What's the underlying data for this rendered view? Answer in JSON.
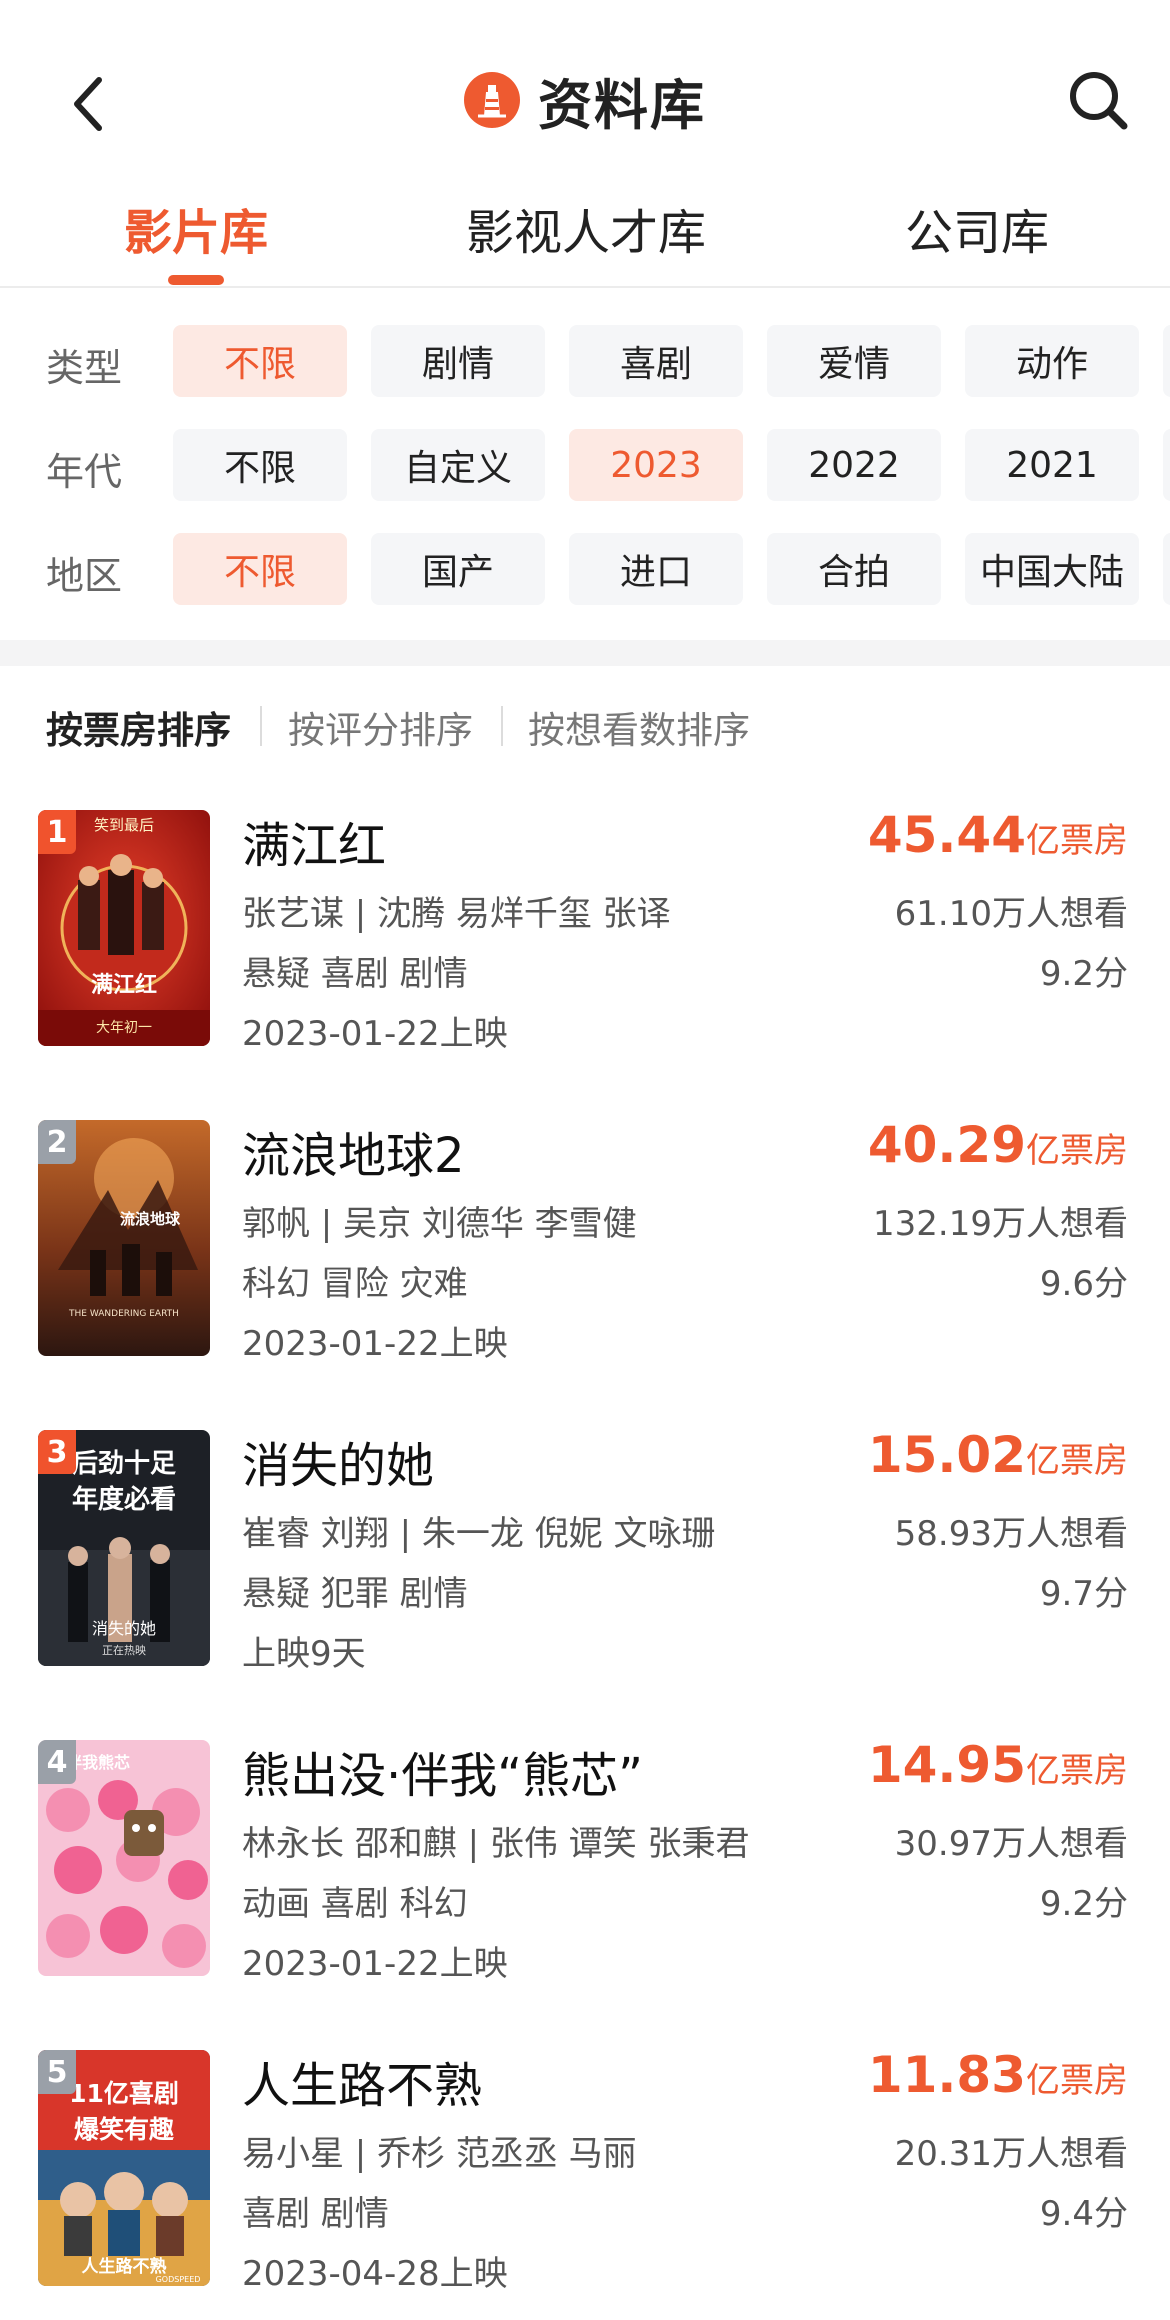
{
  "header": {
    "title": "资料库",
    "back_icon": "chevron-left-icon",
    "logo_icon": "lighthouse-logo-icon",
    "search_icon": "search-icon"
  },
  "tabs": [
    {
      "label": "影片库",
      "active": true
    },
    {
      "label": "影视人才库",
      "active": false
    },
    {
      "label": "公司库",
      "active": false
    }
  ],
  "filters": [
    {
      "label": "类型",
      "options": [
        "不限",
        "剧情",
        "喜剧",
        "爱情",
        "动作"
      ],
      "selected": "不限"
    },
    {
      "label": "年代",
      "options": [
        "不限",
        "自定义",
        "2023",
        "2022",
        "2021"
      ],
      "selected": "2023"
    },
    {
      "label": "地区",
      "options": [
        "不限",
        "国产",
        "进口",
        "合拍",
        "中国大陆"
      ],
      "selected": "不限"
    }
  ],
  "sort": {
    "options": [
      "按票房排序",
      "按评分排序",
      "按想看数排序"
    ],
    "selected": "按票房排序"
  },
  "box_unit": "亿票房",
  "movies": [
    {
      "rank": "1",
      "title": "满江红",
      "cast": "张艺谋 | 沈腾 易烊千玺 张译",
      "genres": "悬疑 喜剧 剧情",
      "release": "2023-01-22上映",
      "box_office": "45.44",
      "want": "61.10万人想看",
      "score": "9.2分"
    },
    {
      "rank": "2",
      "title": "流浪地球2",
      "cast": "郭帆 | 吴京 刘德华 李雪健",
      "genres": "科幻 冒险 灾难",
      "release": "2023-01-22上映",
      "box_office": "40.29",
      "want": "132.19万人想看",
      "score": "9.6分"
    },
    {
      "rank": "3",
      "title": "消失的她",
      "cast": "崔睿 刘翔 | 朱一龙 倪妮 文咏珊",
      "genres": "悬疑 犯罪 剧情",
      "release": "上映9天",
      "box_office": "15.02",
      "want": "58.93万人想看",
      "score": "9.7分"
    },
    {
      "rank": "4",
      "title": "熊出没·伴我“熊芯”",
      "cast": "林永长 邵和麒 | 张伟 谭笑 张秉君",
      "genres": "动画 喜剧 科幻",
      "release": "2023-01-22上映",
      "box_office": "14.95",
      "want": "30.97万人想看",
      "score": "9.2分"
    },
    {
      "rank": "5",
      "title": "人生路不熟",
      "cast": "易小星 | 乔杉 范丞丞 马丽",
      "genres": "喜剧 剧情",
      "release": "2023-04-28上映",
      "box_office": "11.83",
      "want": "20.31万人想看",
      "score": "9.4分"
    }
  ],
  "posters": [
    {
      "text_lines": [
        "笑到最后",
        "满江红",
        "大年初一"
      ]
    },
    {
      "text_lines": [
        "流浪地球",
        "THE WANDERING EARTH"
      ]
    },
    {
      "text_lines": [
        "后劲十足",
        "年度必看",
        "消失的她",
        "正在热映"
      ]
    },
    {
      "text_lines": [
        "伴我熊芯"
      ]
    },
    {
      "text_lines": [
        "11亿喜剧",
        "爆笑有趣",
        "人生路不熟",
        "GODSPEED"
      ]
    }
  ],
  "colors": {
    "accent": "#ee5a30",
    "chip_bg": "#f5f6f8",
    "chip_active_bg": "#fde9e3",
    "rank_top3": "#f0532d",
    "rank_other": "#9aa0a8"
  }
}
